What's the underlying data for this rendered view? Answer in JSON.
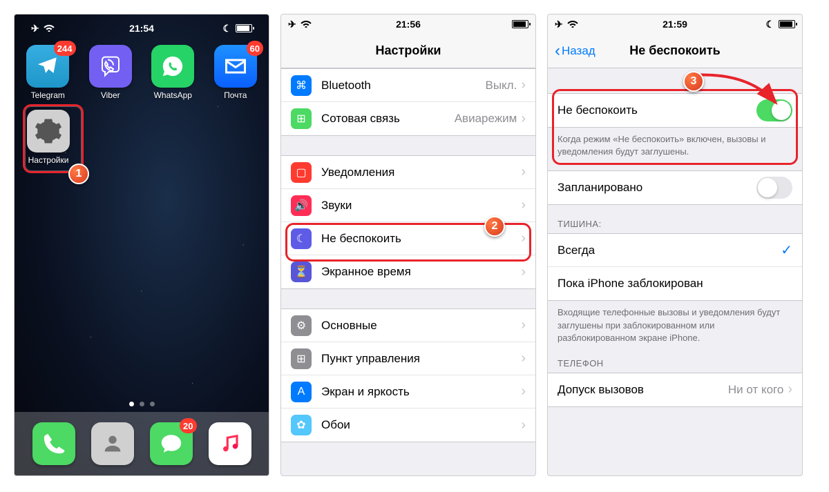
{
  "screen1": {
    "status": {
      "time": "21:54"
    },
    "apps": [
      {
        "label": "Telegram",
        "badge": "244"
      },
      {
        "label": "Viber",
        "badge": null
      },
      {
        "label": "WhatsApp",
        "badge": null
      },
      {
        "label": "Почта",
        "badge": "60"
      }
    ],
    "settings_app": {
      "label": "Настройки"
    },
    "dock": [
      {
        "label": "Телефон"
      },
      {
        "label": "Контакты"
      },
      {
        "label": "Сообщения",
        "badge": "20"
      },
      {
        "label": "Музыка"
      }
    ],
    "step_num": "1"
  },
  "screen2": {
    "status": {
      "time": "21:56"
    },
    "title": "Настройки",
    "groups": {
      "network": [
        {
          "icon": "bluetooth",
          "label": "Bluetooth",
          "value": "Выкл."
        },
        {
          "icon": "cellular",
          "label": "Сотовая связь",
          "value": "Авиарежим"
        }
      ],
      "attention": [
        {
          "icon": "notifications",
          "label": "Уведомления"
        },
        {
          "icon": "sounds",
          "label": "Звуки"
        },
        {
          "icon": "dnd",
          "label": "Не беспокоить"
        },
        {
          "icon": "screentime",
          "label": "Экранное время"
        }
      ],
      "general": [
        {
          "icon": "general",
          "label": "Основные"
        },
        {
          "icon": "cc",
          "label": "Пункт управления"
        },
        {
          "icon": "display",
          "label": "Экран и яркость"
        },
        {
          "icon": "wallpaper",
          "label": "Обои"
        }
      ]
    },
    "step_num": "2"
  },
  "screen3": {
    "status": {
      "time": "21:59"
    },
    "back": "Назад",
    "title": "Не беспокоить",
    "dnd_row": {
      "label": "Не беспокоить"
    },
    "dnd_footer": "Когда режим «Не беспокоить» включен, вызовы и уведомления будут заглушены.",
    "scheduled": {
      "label": "Запланировано"
    },
    "silence_header": "ТИШИНА:",
    "silence_options": [
      {
        "label": "Всегда",
        "checked": true
      },
      {
        "label": "Пока iPhone заблокирован",
        "checked": false
      }
    ],
    "silence_footer": "Входящие телефонные вызовы и уведомления будут заглушены при заблокированном или разблокированном экране iPhone.",
    "phone_header": "ТЕЛЕФОН",
    "allow_calls": {
      "label": "Допуск вызовов",
      "value": "Ни от кого"
    },
    "step_num": "3"
  }
}
